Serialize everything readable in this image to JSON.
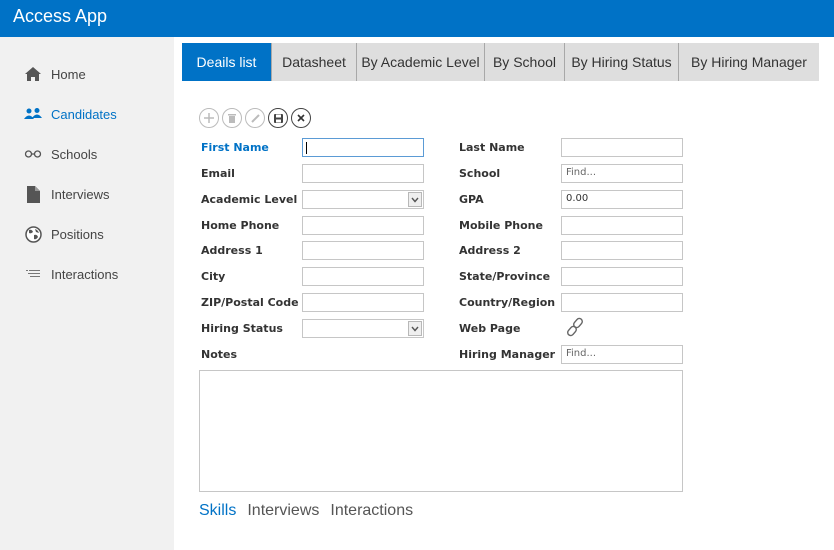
{
  "app": {
    "title": "Access App",
    "accent_color": "#0072c6"
  },
  "sidebar": {
    "items": [
      {
        "label": "Home",
        "icon": "home-icon"
      },
      {
        "label": "Candidates",
        "icon": "people-icon",
        "active": true
      },
      {
        "label": "Schools",
        "icon": "glasses-icon"
      },
      {
        "label": "Interviews",
        "icon": "document-icon"
      },
      {
        "label": "Positions",
        "icon": "globe-icon"
      },
      {
        "label": "Interactions",
        "icon": "list-icon"
      }
    ]
  },
  "tabs": [
    {
      "label": "Deails list",
      "active": true
    },
    {
      "label": "Datasheet"
    },
    {
      "label": "By Academic Level"
    },
    {
      "label": "By School"
    },
    {
      "label": "By Hiring Status"
    },
    {
      "label": "By Hiring Manager"
    }
  ],
  "actions": [
    "add-icon",
    "delete-icon",
    "edit-icon",
    "save-icon",
    "cancel-icon"
  ],
  "form": {
    "left": {
      "first_name": {
        "label": "First Name",
        "value": ""
      },
      "email": {
        "label": "Email",
        "value": ""
      },
      "academic_level": {
        "label": "Academic Level",
        "value": ""
      },
      "home_phone": {
        "label": "Home Phone",
        "value": ""
      },
      "address1": {
        "label": "Address 1",
        "value": ""
      },
      "city": {
        "label": "City",
        "value": ""
      },
      "zip": {
        "label": "ZIP/Postal Code",
        "value": ""
      },
      "hiring_status": {
        "label": "Hiring Status",
        "value": ""
      },
      "notes": {
        "label": "Notes",
        "value": ""
      }
    },
    "right": {
      "last_name": {
        "label": "Last Name",
        "value": ""
      },
      "school": {
        "label": "School",
        "placeholder": "Find..."
      },
      "gpa": {
        "label": "GPA",
        "value": "0.00"
      },
      "mobile_phone": {
        "label": "Mobile Phone",
        "value": ""
      },
      "address2": {
        "label": "Address 2",
        "value": ""
      },
      "state": {
        "label": "State/Province",
        "value": ""
      },
      "country": {
        "label": "Country/Region",
        "value": ""
      },
      "web_page": {
        "label": "Web Page"
      },
      "hiring_manager": {
        "label": "Hiring Manager",
        "placeholder": "Find..."
      }
    }
  },
  "subtabs": [
    {
      "label": "Skills",
      "active": true
    },
    {
      "label": "Interviews"
    },
    {
      "label": "Interactions"
    }
  ]
}
